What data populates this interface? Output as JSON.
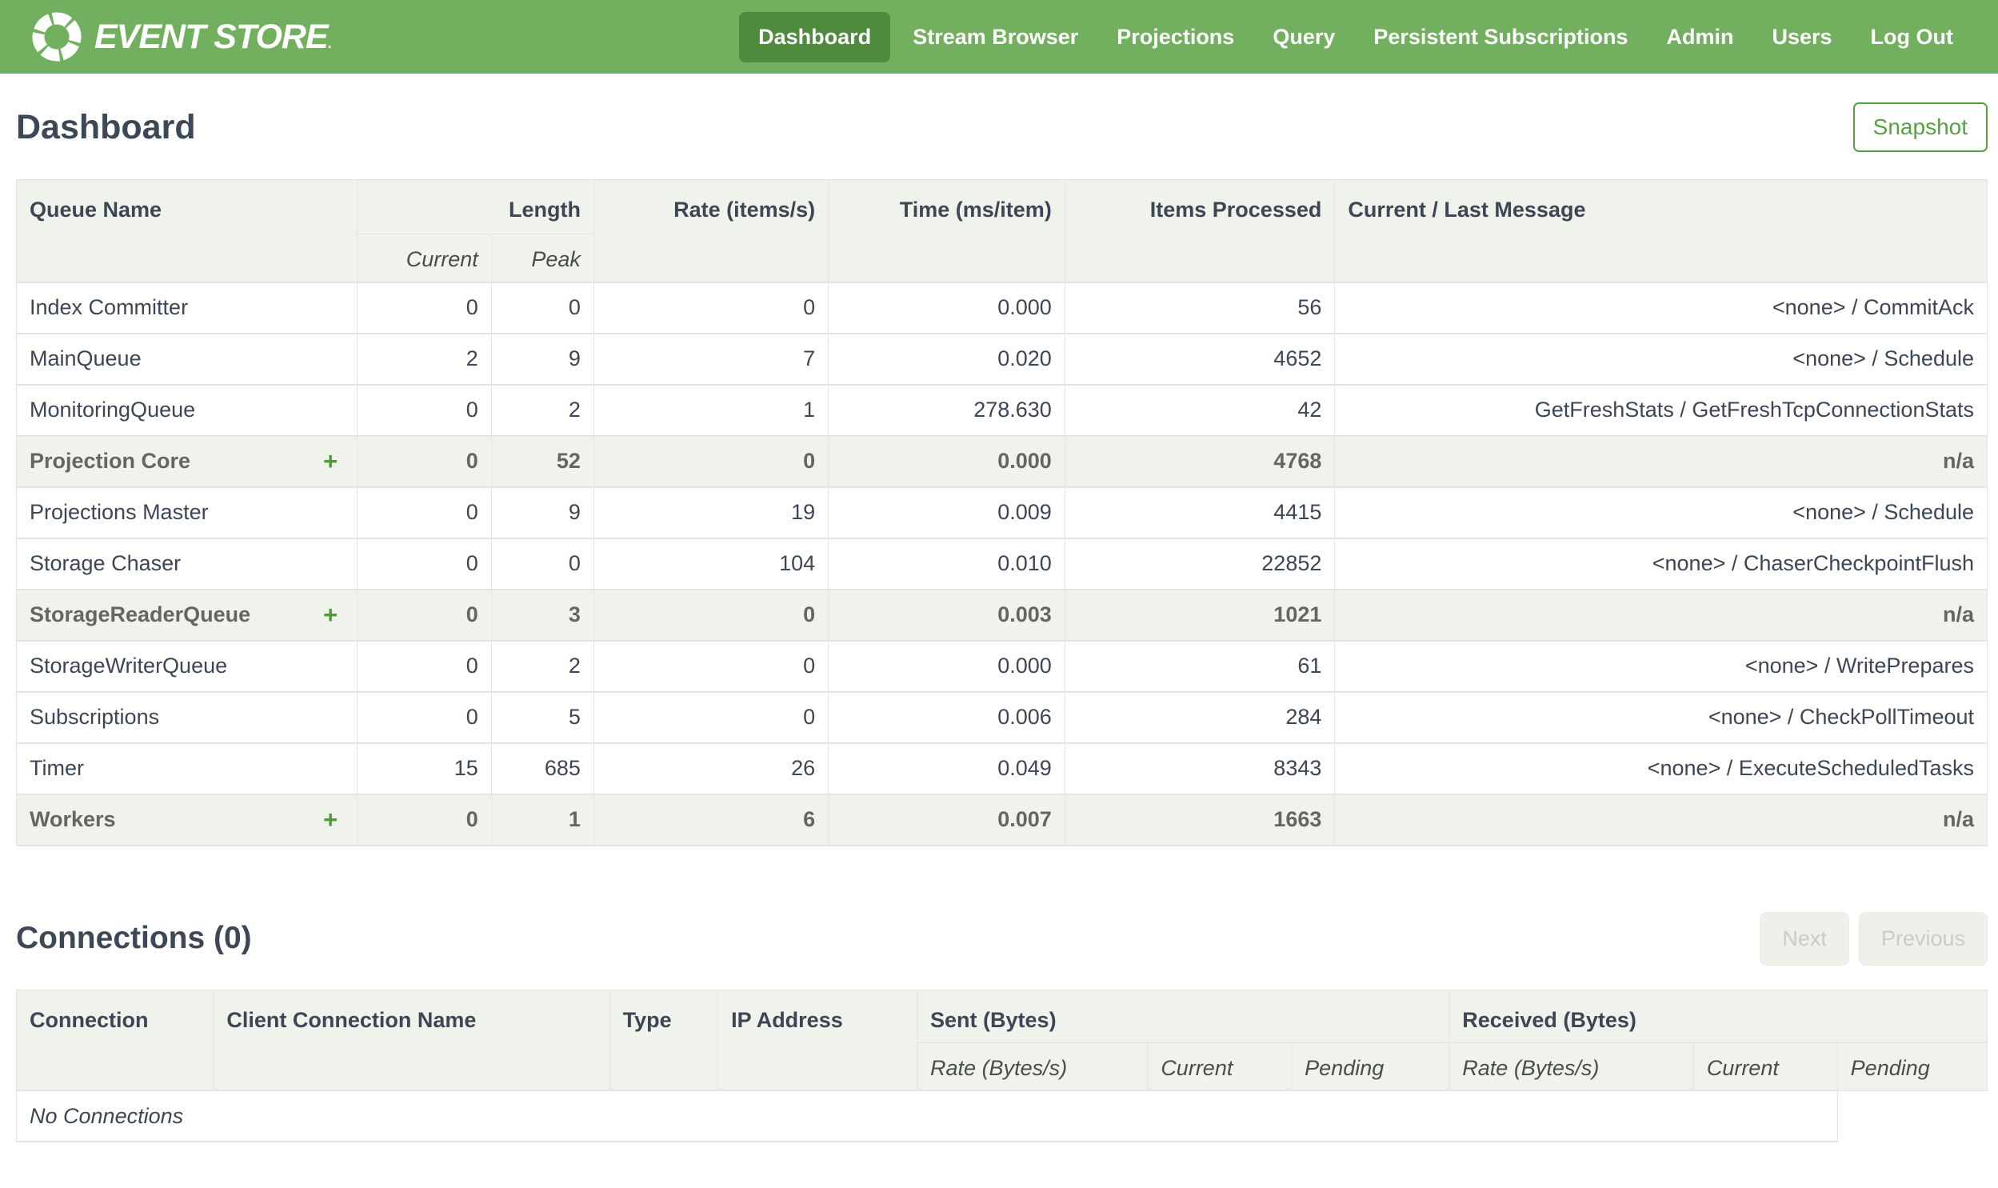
{
  "nav": {
    "brand": {
      "text": "EVENT STORE",
      "mark": "."
    },
    "items": [
      {
        "label": "Dashboard",
        "active": true
      },
      {
        "label": "Stream Browser",
        "active": false
      },
      {
        "label": "Projections",
        "active": false
      },
      {
        "label": "Query",
        "active": false
      },
      {
        "label": "Persistent Subscriptions",
        "active": false
      },
      {
        "label": "Admin",
        "active": false
      },
      {
        "label": "Users",
        "active": false
      },
      {
        "label": "Log Out",
        "active": false
      }
    ]
  },
  "page": {
    "title": "Dashboard",
    "snapshot_button": "Snapshot"
  },
  "icons": {
    "plus": "+"
  },
  "queue_table": {
    "headers": {
      "queue_name": "Queue Name",
      "length": "Length",
      "current": "Current",
      "peak": "Peak",
      "rate": "Rate (items/s)",
      "time": "Time (ms/item)",
      "items_processed": "Items Processed",
      "message": "Current / Last Message"
    },
    "rows": [
      {
        "name": "Index Committer",
        "group": false,
        "current": "0",
        "peak": "0",
        "rate": "0",
        "time": "0.000",
        "items": "56",
        "message": "<none> / CommitAck"
      },
      {
        "name": "MainQueue",
        "group": false,
        "current": "2",
        "peak": "9",
        "rate": "7",
        "time": "0.020",
        "items": "4652",
        "message": "<none> / Schedule"
      },
      {
        "name": "MonitoringQueue",
        "group": false,
        "current": "0",
        "peak": "2",
        "rate": "1",
        "time": "278.630",
        "items": "42",
        "message": "GetFreshStats / GetFreshTcpConnectionStats"
      },
      {
        "name": "Projection Core",
        "group": true,
        "current": "0",
        "peak": "52",
        "rate": "0",
        "time": "0.000",
        "items": "4768",
        "message": "n/a"
      },
      {
        "name": "Projections Master",
        "group": false,
        "current": "0",
        "peak": "9",
        "rate": "19",
        "time": "0.009",
        "items": "4415",
        "message": "<none> / Schedule"
      },
      {
        "name": "Storage Chaser",
        "group": false,
        "current": "0",
        "peak": "0",
        "rate": "104",
        "time": "0.010",
        "items": "22852",
        "message": "<none> / ChaserCheckpointFlush"
      },
      {
        "name": "StorageReaderQueue",
        "group": true,
        "current": "0",
        "peak": "3",
        "rate": "0",
        "time": "0.003",
        "items": "1021",
        "message": "n/a"
      },
      {
        "name": "StorageWriterQueue",
        "group": false,
        "current": "0",
        "peak": "2",
        "rate": "0",
        "time": "0.000",
        "items": "61",
        "message": "<none> / WritePrepares"
      },
      {
        "name": "Subscriptions",
        "group": false,
        "current": "0",
        "peak": "5",
        "rate": "0",
        "time": "0.006",
        "items": "284",
        "message": "<none> / CheckPollTimeout"
      },
      {
        "name": "Timer",
        "group": false,
        "current": "15",
        "peak": "685",
        "rate": "26",
        "time": "0.049",
        "items": "8343",
        "message": "<none> / ExecuteScheduledTasks"
      },
      {
        "name": "Workers",
        "group": true,
        "current": "0",
        "peak": "1",
        "rate": "6",
        "time": "0.007",
        "items": "1663",
        "message": "n/a"
      }
    ]
  },
  "connections": {
    "title": "Connections (0)",
    "next_button": "Next",
    "previous_button": "Previous",
    "headers": {
      "connection": "Connection",
      "client_name": "Client Connection Name",
      "type": "Type",
      "ip": "IP Address",
      "sent": "Sent (Bytes)",
      "received": "Received (Bytes)",
      "rate": "Rate (Bytes/s)",
      "current": "Current",
      "pending": "Pending"
    },
    "empty_message": "No Connections"
  },
  "colors": {
    "nav_green": "#72b05f",
    "active_nav_green": "#4e8b3c",
    "accent_green": "#55a33e",
    "plus_green": "#4f9a36",
    "header_bg": "#f0f2ec",
    "text_dark": "#3c4654"
  }
}
